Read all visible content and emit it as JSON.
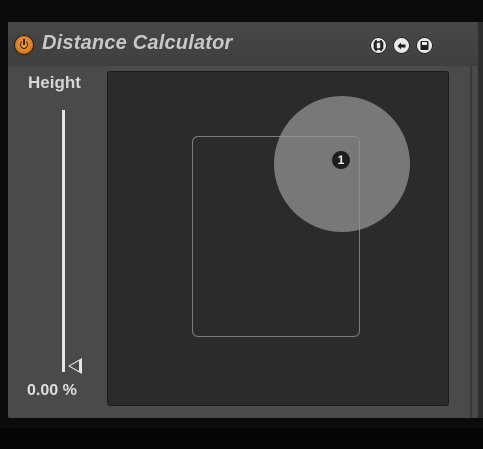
{
  "device": {
    "title": "Distance Calculator",
    "power_icon": "power-icon",
    "header_buttons": [
      "map-icon",
      "sync-icon",
      "save-icon"
    ]
  },
  "height_control": {
    "label": "Height",
    "value_text": "0.00 %",
    "value_fraction": 0.0
  },
  "xy_pad": {
    "source_marker_label": "1"
  },
  "colors": {
    "power_accent": "#d9822b",
    "panel_bg": "#4a4a4a",
    "pad_bg": "#2b2b2b",
    "text": "#d6d6d6"
  }
}
